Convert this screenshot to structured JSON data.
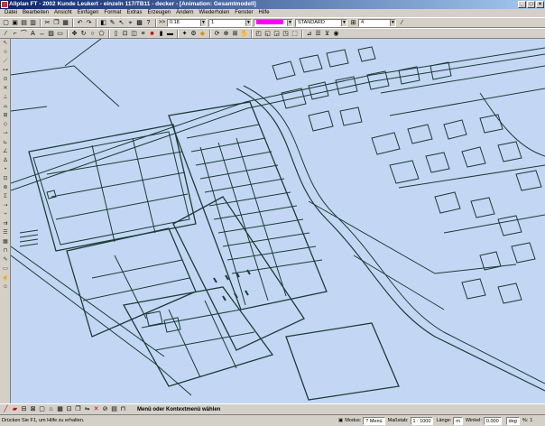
{
  "window": {
    "title": "Allplan FT - 2002 Kunde Leukert - einzeln 117/TB11 - decker - [Animation: Gesamtmodell]",
    "minimize": "_",
    "maximize": "□",
    "close": "×"
  },
  "menu": [
    "Datei",
    "Bearbeiten",
    "Ansicht",
    "Einfügen",
    "Format",
    "Extras",
    "Erzeugen",
    "Ändern",
    "Wiederholen",
    "Fenster",
    "Hilfe"
  ],
  "toolbar": {
    "pen_thickness": "0.18",
    "line_type": "1",
    "color_value": "",
    "layer": "STANDARD",
    "drawing_number": "4",
    "prefix": ">>",
    "accent_color": "#ff00ff"
  },
  "command_bar": {
    "label": "Menü oder Kontextmenü wählen"
  },
  "status": {
    "hint": "Drücken Sie F1, um Hilfe zu erhalten.",
    "modus_label": "Modus:",
    "modus_value": "? Menü",
    "massstab_label": "Maßstab:",
    "massstab_value": "1 : 1000",
    "laenge_label": "Länge:",
    "laenge_value": "m",
    "winkel_label": "Winkel:",
    "winkel_value": "0.000",
    "deg_label": "deg",
    "percent_label": "%:",
    "percent_value": "1"
  },
  "colors": {
    "viewport_bg": "#c3d7f4",
    "line": "#1b3d35"
  }
}
